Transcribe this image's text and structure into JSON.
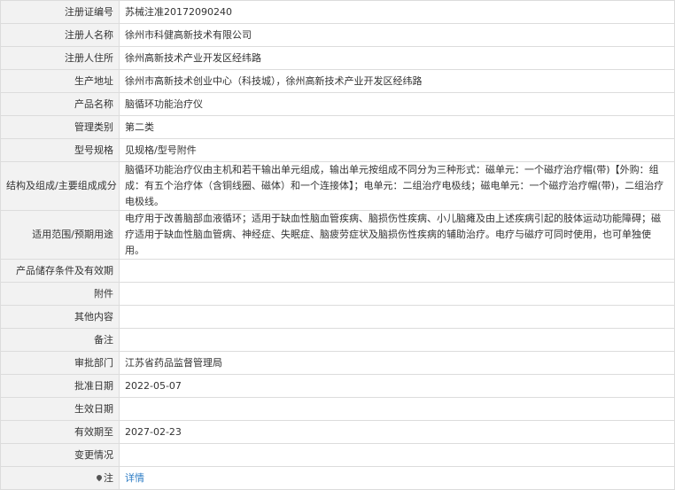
{
  "fields": [
    {
      "label": "注册证编号",
      "value": "苏械注准20172090240"
    },
    {
      "label": "注册人名称",
      "value": "徐州市科健高新技术有限公司"
    },
    {
      "label": "注册人住所",
      "value": "徐州高新技术产业开发区经纬路"
    },
    {
      "label": "生产地址",
      "value": "徐州市高新技术创业中心（科技城），徐州高新技术产业开发区经纬路"
    },
    {
      "label": "产品名称",
      "value": "脑循环功能治疗仪"
    },
    {
      "label": "管理类别",
      "value": "第二类"
    },
    {
      "label": "型号规格",
      "value": "见规格/型号附件"
    },
    {
      "label": "结构及组成/主要组成成分",
      "value": "脑循环功能治疗仪由主机和若干输出单元组成，输出单元按组成不同分为三种形式：磁单元：一个磁疗治疗帽(带)【外购：组成：有五个治疗体（含铜线圈、磁体）和一个连接体】；电单元：二组治疗电极线；磁电单元：一个磁疗治疗帽(带)，二组治疗电极线。"
    },
    {
      "label": "适用范围/预期用途",
      "value": "电疗用于改善脑部血液循环；适用于缺血性脑血管疾病、脑损伤性疾病、小儿脑瘫及由上述疾病引起的肢体运动功能障碍；磁疗适用于缺血性脑血管病、神经症、失眠症、脑疲劳症状及脑损伤性疾病的辅助治疗。电疗与磁疗可同时使用，也可单独使用。"
    },
    {
      "label": "产品储存条件及有效期",
      "value": ""
    },
    {
      "label": "附件",
      "value": ""
    },
    {
      "label": "其他内容",
      "value": ""
    },
    {
      "label": "备注",
      "value": ""
    },
    {
      "label": "审批部门",
      "value": "江苏省药品监督管理局"
    },
    {
      "label": "批准日期",
      "value": "2022-05-07"
    },
    {
      "label": "生效日期",
      "value": ""
    },
    {
      "label": "有效期至",
      "value": "2027-02-23"
    },
    {
      "label": "变更情况",
      "value": ""
    }
  ],
  "note": {
    "label": "注",
    "icon": "pin-icon",
    "link_text": "详情",
    "link_color": "#2b7bc4"
  }
}
